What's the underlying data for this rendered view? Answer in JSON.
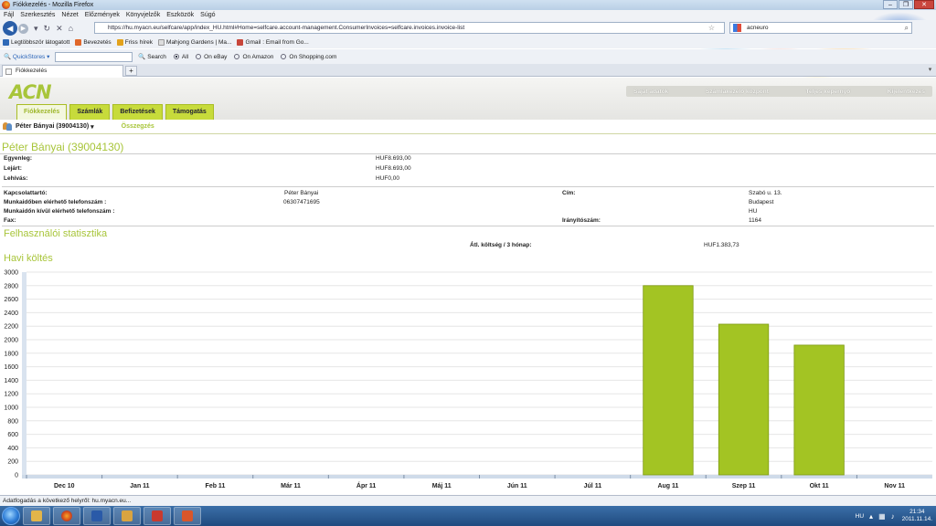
{
  "window": {
    "title": "Fiókkezelés - Mozilla Firefox",
    "controls": [
      "–",
      "❐",
      "✕"
    ]
  },
  "menu": [
    "Fájl",
    "Szerkesztés",
    "Nézet",
    "Előzmények",
    "Könyvjelzők",
    "Eszközök",
    "Súgó"
  ],
  "navbar": {
    "url": "https://hu.myacn.eu/selfcare/app/index_HU.html#Home=selfcare.account-management.ConsumerInvoices=selfcare.invoices.invoice-list",
    "search_value": "acneuro"
  },
  "bookmarks": [
    {
      "label": "Legtöbbször látogatott",
      "color": "#2f6ab8"
    },
    {
      "label": "Bevezetés",
      "color": "#e0672a"
    },
    {
      "label": "Friss hírek",
      "color": "#e3a21b"
    },
    {
      "label": "Mahjong Gardens | Ma...",
      "color": "#dddddd"
    },
    {
      "label": "Gmail : Email from Go...",
      "color": "#c8463a"
    }
  ],
  "quickbar": {
    "label": "QuickStores",
    "search": "Search",
    "options": [
      {
        "label": "All",
        "selected": true
      },
      {
        "label": "On eBay",
        "selected": false
      },
      {
        "label": "On Amazon",
        "selected": false
      },
      {
        "label": "On Shopping.com",
        "selected": false
      }
    ]
  },
  "tab": {
    "label": "Fiókkezelés",
    "new_tab": "+"
  },
  "site": {
    "logo": "ACN",
    "toplinks": [
      "Saját adatok",
      "Számlakezelő központ",
      "Teljes képernyő",
      "Kijelentkezés"
    ],
    "nav": [
      {
        "label": "Fiókkezelés",
        "active": true
      },
      {
        "label": "Számlák",
        "active": false
      },
      {
        "label": "Befizetések",
        "active": false
      },
      {
        "label": "Támogatás",
        "active": false
      }
    ],
    "user": "Péter Bányai (39004130)",
    "summary_link": "Összegzés"
  },
  "account": {
    "heading": "Péter Bányai (39004130)",
    "balance_rows": [
      {
        "label": "Egyenleg:",
        "value": "HUF8.693,00"
      },
      {
        "label": "Lejárt:",
        "value": "HUF8.693,00"
      },
      {
        "label": "Lehívás:",
        "value": "HUF0,00"
      }
    ],
    "contact": {
      "contact_label": "Kapcsolattartó:",
      "contact_value": "Péter  Bányai",
      "day_phone_label": "Munkaidőben elérhető telefonszám :",
      "day_phone_value": "06307471695",
      "evening_phone_label": "Munkaidőn kívül elérhető telefonszám :",
      "fax_label": "Fax:",
      "address_label": "Cím:",
      "address_lines": [
        "Szabó u. 13.",
        "Budapest",
        "HU"
      ],
      "zip_label": "Irányítószám:",
      "zip_value": "1164"
    }
  },
  "stats": {
    "heading": "Felhasználói statisztika",
    "avg_label": "Átl. költség / 3 hónap:",
    "avg_value": "HUF1.383,73"
  },
  "chart_data": {
    "type": "bar",
    "title": "Havi költés",
    "categories": [
      "Dec 10",
      "Jan 11",
      "Feb 11",
      "Már 11",
      "Ápr 11",
      "Máj 11",
      "Jún 11",
      "Júl 11",
      "Aug 11",
      "Szep 11",
      "Okt 11",
      "Nov 11"
    ],
    "values": [
      0,
      0,
      0,
      0,
      0,
      0,
      0,
      0,
      2800,
      2230,
      1920,
      0
    ],
    "ylim": [
      0,
      3000
    ],
    "yticks": [
      0,
      200,
      400,
      600,
      800,
      1000,
      1200,
      1400,
      1600,
      1800,
      2000,
      2200,
      2400,
      2600,
      2800,
      3000
    ],
    "xlabel": "",
    "ylabel": "",
    "grid": true,
    "bar_color": "#a3c423"
  },
  "status_bar": "Adatfogadás a következő helyről: hu.myacn.eu...",
  "taskbar": {
    "lang": "HU",
    "time": "21:34",
    "date": "2011.11.14."
  }
}
